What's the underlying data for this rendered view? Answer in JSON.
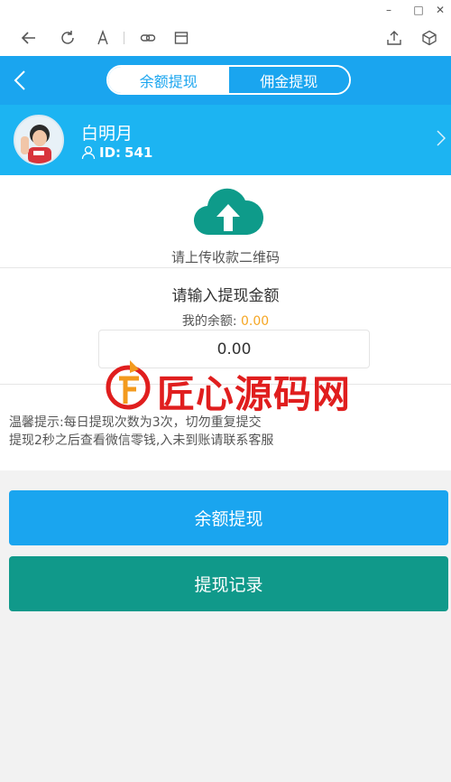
{
  "window": {
    "minimize": "–",
    "maximize": "□",
    "close": "✕"
  },
  "browser": {
    "icons": [
      "back-icon",
      "refresh-icon",
      "font-icon",
      "link-icon",
      "window-icon",
      "share-icon",
      "cube-icon"
    ]
  },
  "header": {
    "tabs": [
      {
        "label": "余额提现",
        "active": true
      },
      {
        "label": "佣金提现",
        "active": false
      }
    ]
  },
  "profile": {
    "name": "白明月",
    "id_label": "ID:",
    "id_value": "541"
  },
  "upload": {
    "text": "请上传收款二维码"
  },
  "amount": {
    "title": "请输入提现金额",
    "balance_label": "我的余额:",
    "balance_value": "0.00",
    "input_value": "0.00"
  },
  "tips": {
    "line1": "温馨提示:每日提现次数为3次，切勿重复提交",
    "line2": "提现2秒之后查看微信零钱,入未到账请联系客服"
  },
  "watermark": {
    "text": "匠心源码网"
  },
  "buttons": {
    "withdraw": "余额提现",
    "record": "提现记录"
  },
  "colors": {
    "primary": "#1aa5ef",
    "profile_bg": "#1cb4f2",
    "cloud": "#0e9b8a",
    "record_btn": "#10998a",
    "balance": "#f5a623",
    "watermark": "#e01e1e"
  }
}
